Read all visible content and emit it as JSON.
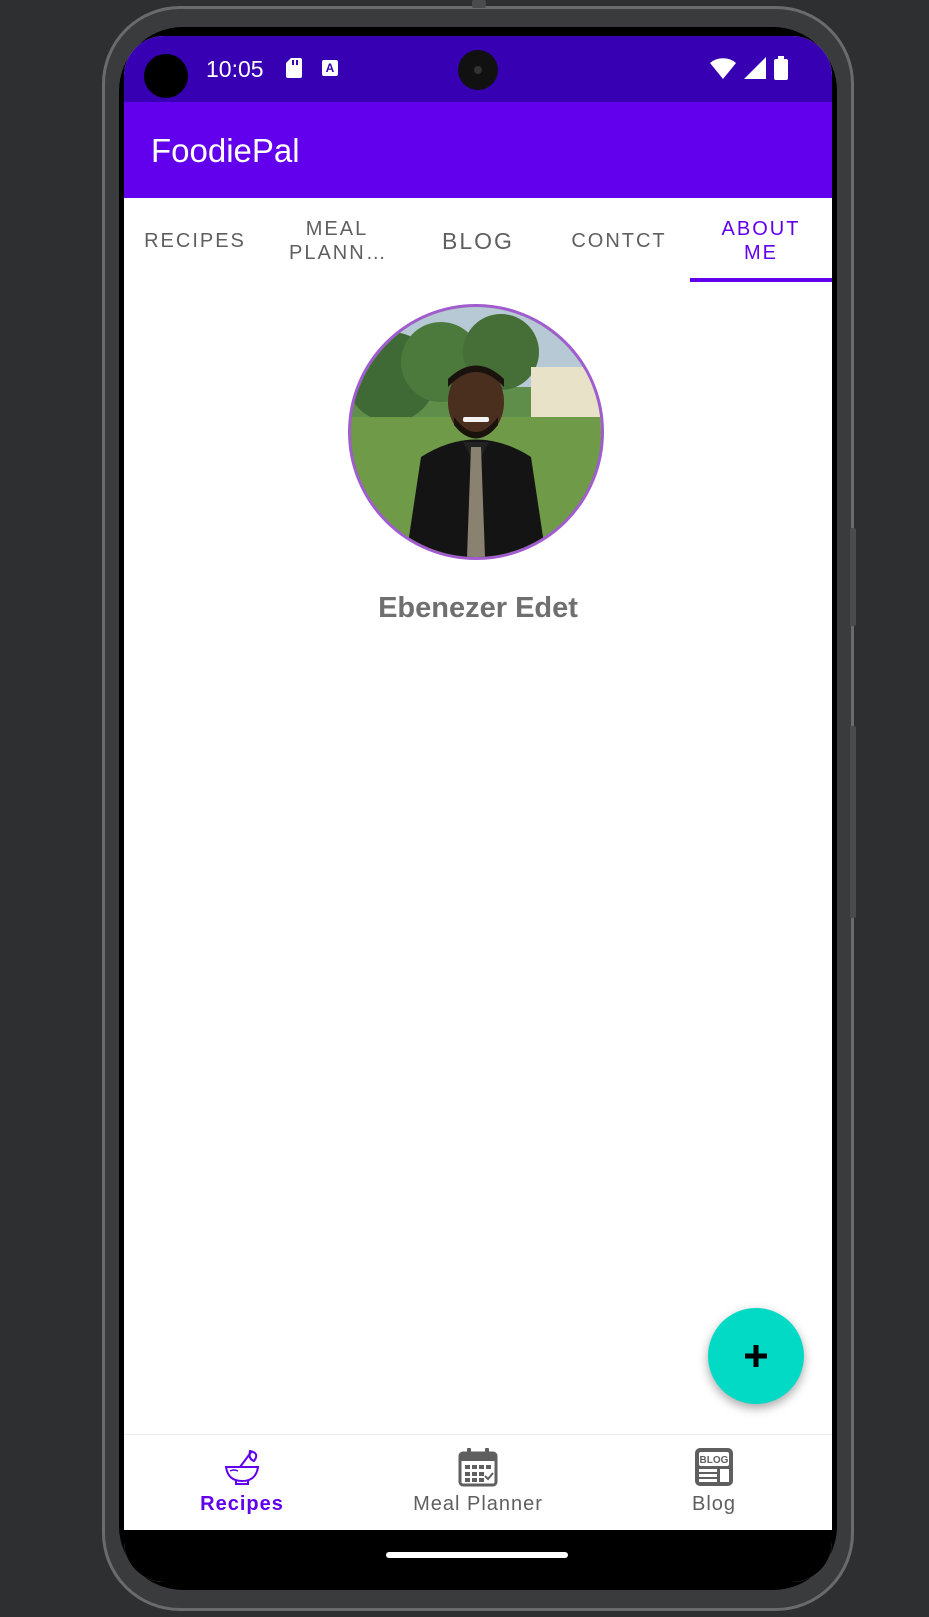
{
  "status_bar": {
    "time": "10:05"
  },
  "app_bar": {
    "title": "FoodiePal"
  },
  "tabs": [
    {
      "label": "RECIPES",
      "active": false
    },
    {
      "label": "MEAL PLANN…",
      "active": false
    },
    {
      "label": "BLOG",
      "active": false
    },
    {
      "label": "CONTCT",
      "active": false
    },
    {
      "label": "ABOUT ME",
      "active": true
    }
  ],
  "profile": {
    "name": "Ebenezer Edet"
  },
  "fab": {
    "icon": "plus-icon"
  },
  "bottom_nav": [
    {
      "label": "Recipes",
      "icon": "mixing-bowl-icon",
      "active": true
    },
    {
      "label": "Meal Planner",
      "icon": "calendar-icon",
      "active": false
    },
    {
      "label": "Blog",
      "icon": "blog-icon",
      "active": false
    }
  ],
  "colors": {
    "primary": "#6200ee",
    "primary_dark": "#3700b3",
    "accent": "#03dac5",
    "avatar_border": "#a15ccf"
  }
}
